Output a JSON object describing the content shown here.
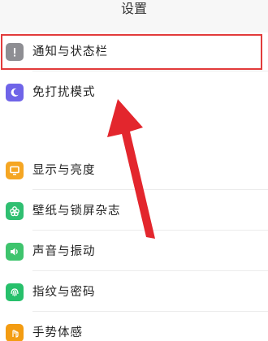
{
  "header": {
    "title": "设置"
  },
  "settings": {
    "items": [
      {
        "label": "通知与状态栏",
        "icon": "notification-icon",
        "color": "#8e8e93"
      },
      {
        "label": "免打扰模式",
        "icon": "moon-icon",
        "color": "#6f64e8"
      },
      {
        "label": "显示与亮度",
        "icon": "display-icon",
        "color": "#f5a623"
      },
      {
        "label": "壁纸与锁屏杂志",
        "icon": "flower-icon",
        "color": "#2fbf71"
      },
      {
        "label": "声音与振动",
        "icon": "speaker-icon",
        "color": "#3ec46d"
      },
      {
        "label": "指纹与密码",
        "icon": "fingerprint-icon",
        "color": "#27c06b"
      },
      {
        "label": "手势体感",
        "icon": "gesture-icon",
        "color": "#f39c12"
      }
    ]
  },
  "annotation": {
    "highlight_color": "#e23b3b",
    "arrow_color": "#e3262d"
  }
}
